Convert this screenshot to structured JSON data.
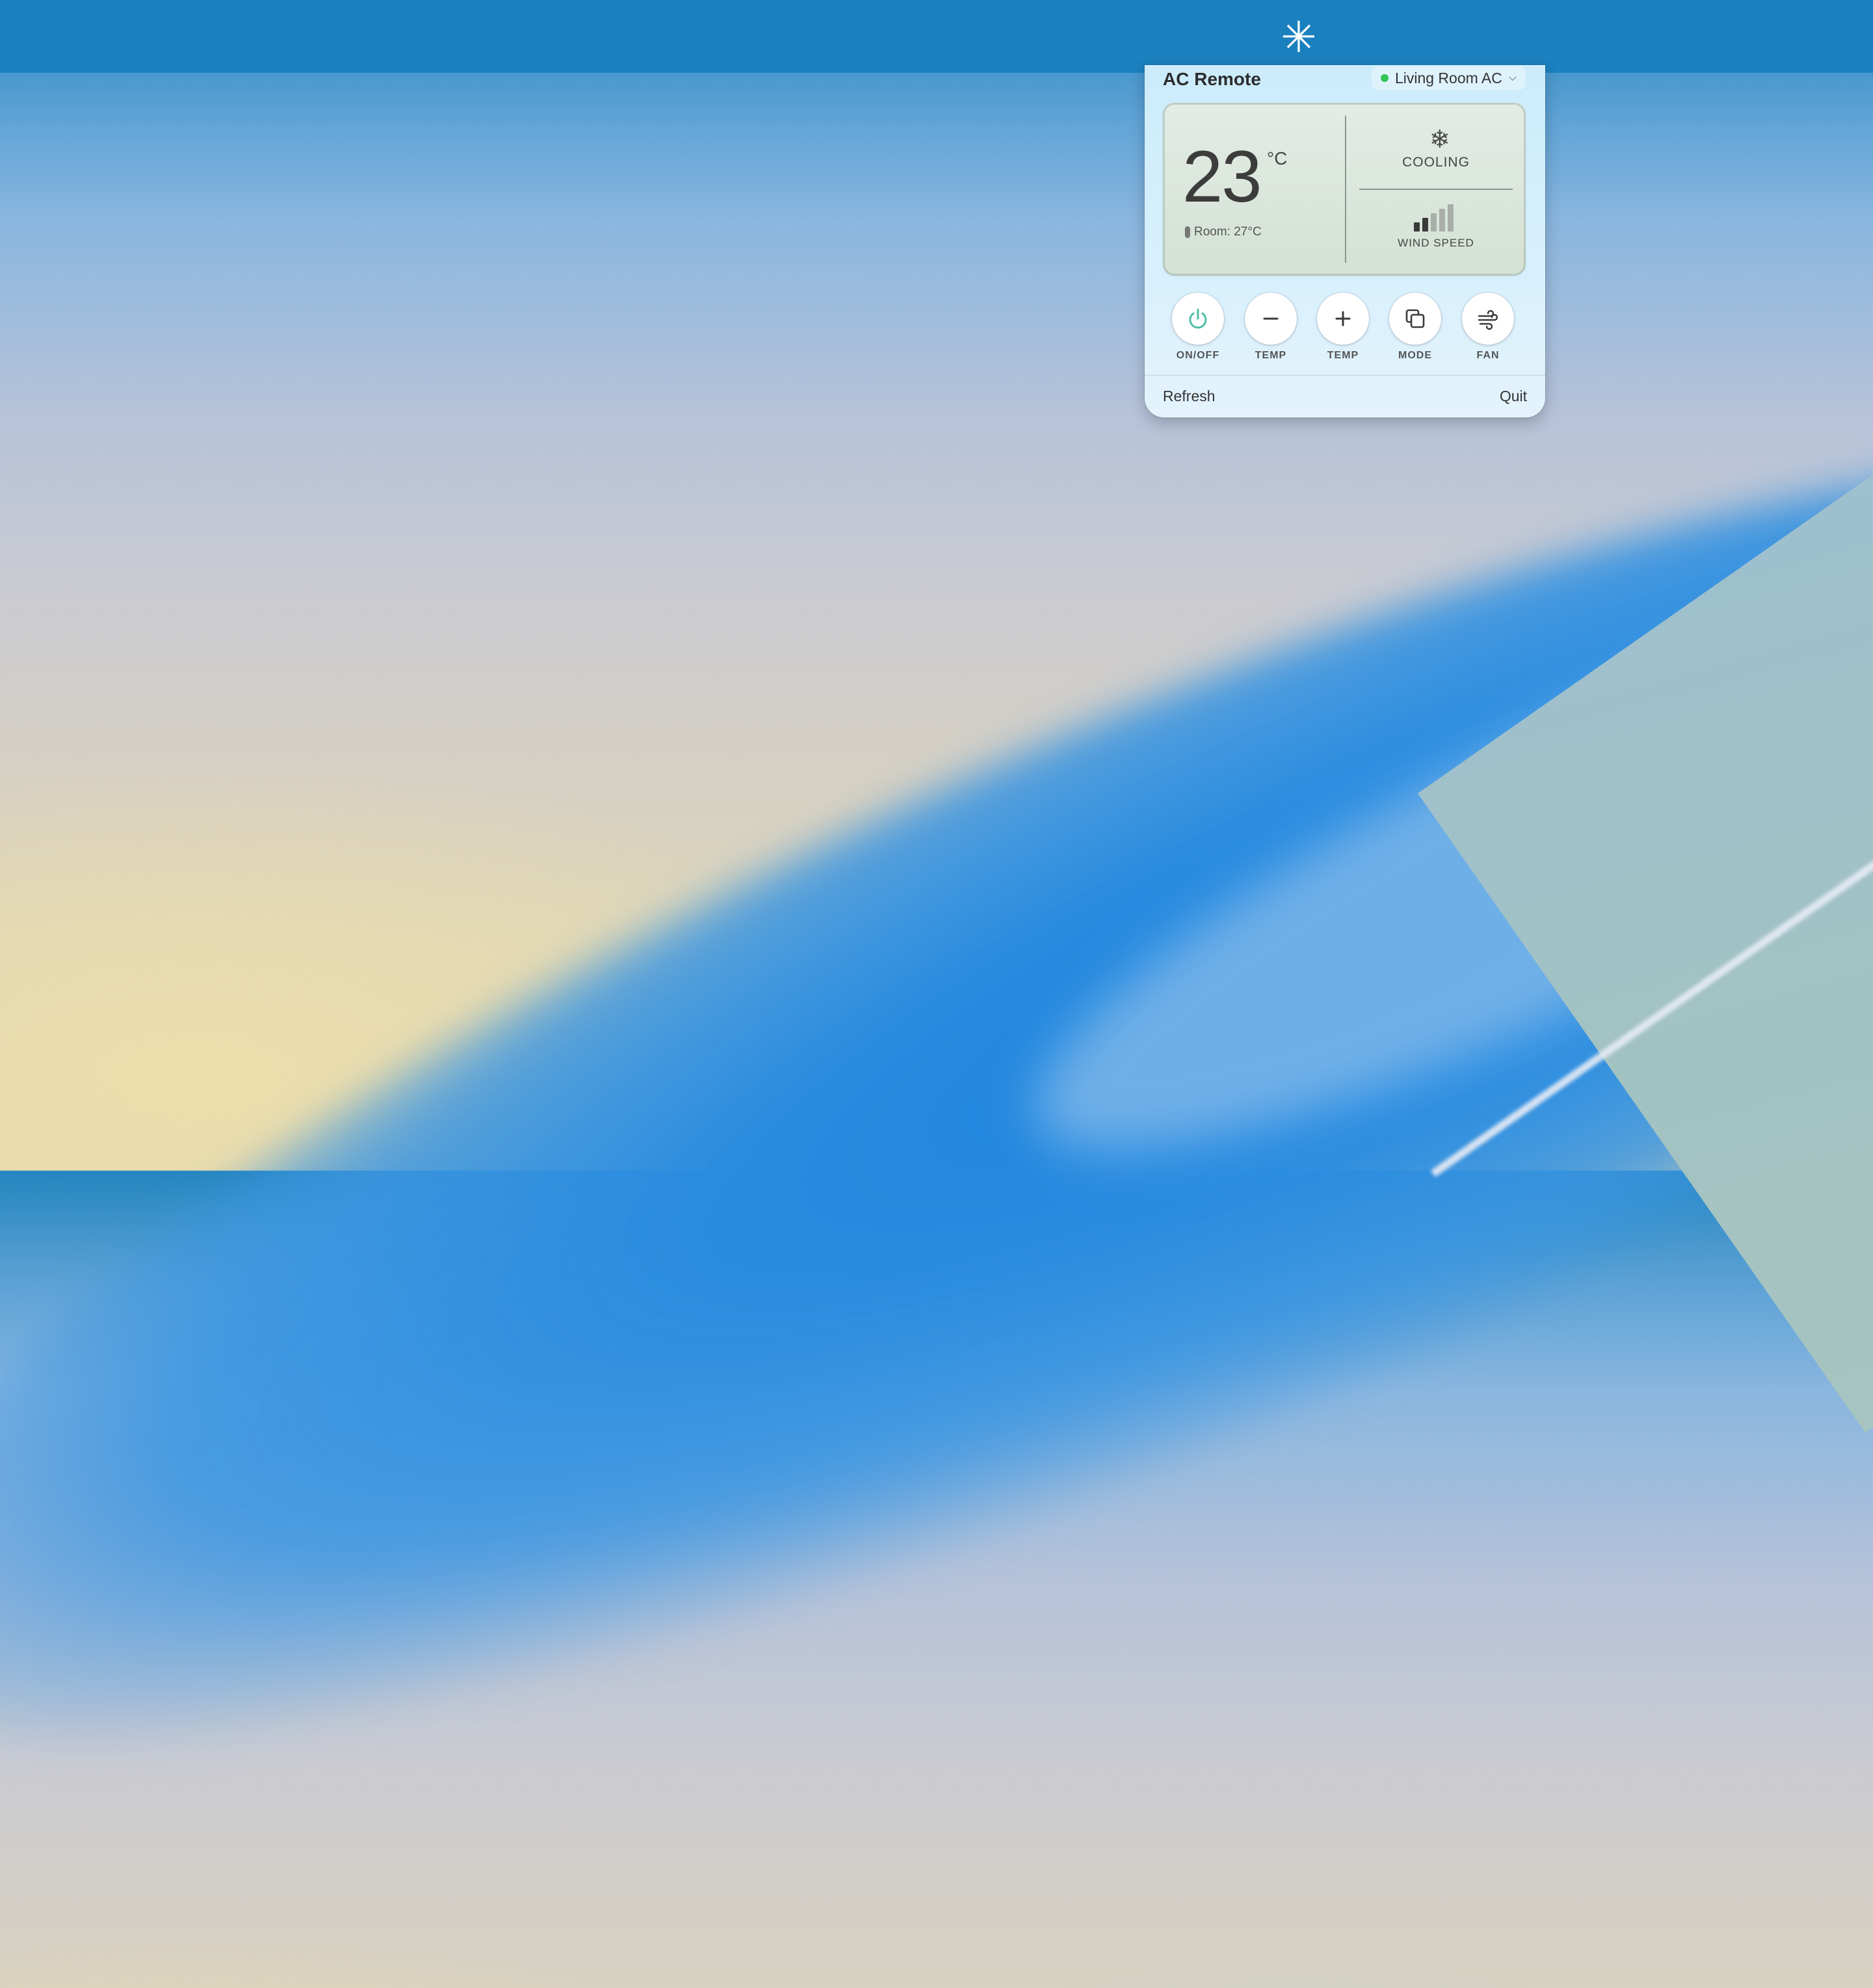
{
  "menubar": {
    "icon": "snowflake-icon",
    "glyph": "✳"
  },
  "panel": {
    "title": "AC Remote",
    "device": {
      "name": "Living Room AC",
      "status_color": "#31c552",
      "chevron": "⌵"
    },
    "display": {
      "set_temp": "23",
      "unit": "°C",
      "room_temp": "Room: 27°C",
      "mode_icon": "❄",
      "mode": "COOLING",
      "wind_speed_label": "WIND SPEED",
      "wind_speed_level": 2,
      "wind_speed_max": 5
    },
    "controls": [
      {
        "label": "ON/OFF",
        "icon": "power-icon"
      },
      {
        "label": "TEMP",
        "icon": "minus-icon"
      },
      {
        "label": "TEMP",
        "icon": "plus-icon"
      },
      {
        "label": "MODE",
        "icon": "mode-icon"
      },
      {
        "label": "FAN",
        "icon": "fan-icon"
      }
    ],
    "footer": {
      "refresh": "Refresh",
      "quit": "Quit"
    }
  },
  "colors": {
    "accent": "#4ec0a5",
    "menubar": "#1980be"
  }
}
